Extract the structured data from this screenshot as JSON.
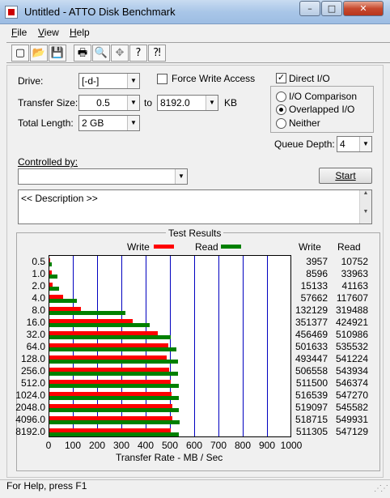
{
  "window": {
    "title": "Untitled - ATTO Disk Benchmark",
    "min": "–",
    "max": "□",
    "close": "✕"
  },
  "menu": [
    {
      "first": "F",
      "rest": "ile"
    },
    {
      "first": "V",
      "rest": "iew"
    },
    {
      "first": "H",
      "rest": "elp"
    }
  ],
  "toolbar": [
    "new-icon",
    "open-icon",
    "save-icon",
    "print-icon",
    "print-preview-icon",
    "move-icon",
    "help-icon",
    "context-help-icon"
  ],
  "toolbar_glyphs": [
    "▢",
    "📂",
    "💾",
    "🖶",
    "🔍",
    "✥",
    "?",
    "⁈"
  ],
  "form": {
    "drive_label": "Drive:",
    "drive_value": "[-d-]",
    "force_write_label": "Force Write Access",
    "direct_io_label": "Direct I/O",
    "transfer_size_label": "Transfer Size:",
    "transfer_from": "0.5",
    "to_label": "to",
    "transfer_to": "8192.0",
    "kb_label": "KB",
    "total_length_label": "Total Length:",
    "total_length_value": "2 GB",
    "radio_io_comparison": "I/O Comparison",
    "radio_overlapped": "Overlapped I/O",
    "radio_neither": "Neither",
    "queue_depth_label": "Queue Depth:",
    "queue_depth_value": "4",
    "controlled_by_label": "Controlled by:",
    "controlled_by_value": "",
    "start_label": "Start",
    "description": "<< Description >>"
  },
  "status": {
    "text": "For Help, press F1"
  },
  "chart_data": {
    "type": "bar",
    "title": "Test Results",
    "xlabel": "Transfer Rate - MB / Sec",
    "xlim": [
      0,
      1000
    ],
    "xticks": [
      "0",
      "100",
      "200",
      "300",
      "400",
      "500",
      "600",
      "700",
      "800",
      "900",
      "1000"
    ],
    "categories": [
      "0.5",
      "1.0",
      "2.0",
      "4.0",
      "8.0",
      "16.0",
      "32.0",
      "64.0",
      "128.0",
      "256.0",
      "512.0",
      "1024.0",
      "2048.0",
      "4096.0",
      "8192.0"
    ],
    "legend": {
      "write": "Write",
      "read": "Read"
    },
    "columns": {
      "write": "Write",
      "read": "Read"
    },
    "colors": {
      "write": "#ff0000",
      "read": "#008000"
    },
    "series": [
      {
        "name": "Write",
        "values": [
          3957,
          8596,
          15133,
          57662,
          132129,
          351377,
          456469,
          501633,
          493447,
          506558,
          511500,
          516539,
          519097,
          518715,
          511305
        ]
      },
      {
        "name": "Read",
        "values": [
          10752,
          33963,
          41163,
          117607,
          319488,
          424921,
          510986,
          535532,
          541224,
          543934,
          546374,
          547270,
          545582,
          549931,
          547129
        ]
      }
    ]
  }
}
